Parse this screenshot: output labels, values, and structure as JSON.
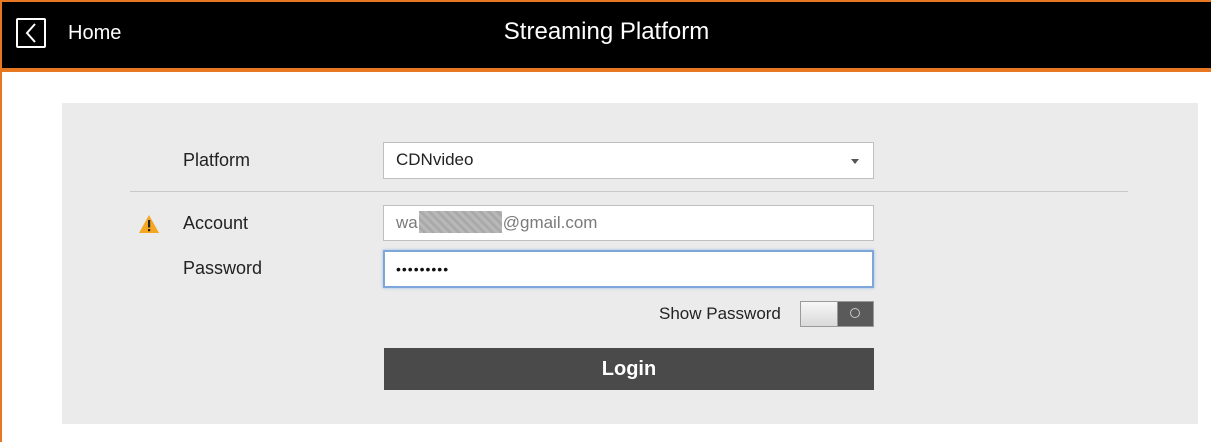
{
  "header": {
    "back_icon": "chevron-left-icon",
    "home_label": "Home",
    "title": "Streaming Platform"
  },
  "form": {
    "platform": {
      "label": "Platform",
      "selected_value": "CDNvideo"
    },
    "account": {
      "label": "Account",
      "warning_icon": "warning-triangle-icon",
      "value_prefix": "wa",
      "value_suffix": "@gmail.com"
    },
    "password": {
      "label": "Password",
      "masked_value": "•••••••••"
    },
    "show_password": {
      "label": "Show Password",
      "enabled": false
    },
    "login_label": "Login"
  },
  "colors": {
    "accent": "#e87722",
    "header_bg": "#000000",
    "card_bg": "#ebebeb",
    "login_bg": "#4a4a4a",
    "warning": "#f5a623",
    "focus_border": "#7ea6d9"
  }
}
